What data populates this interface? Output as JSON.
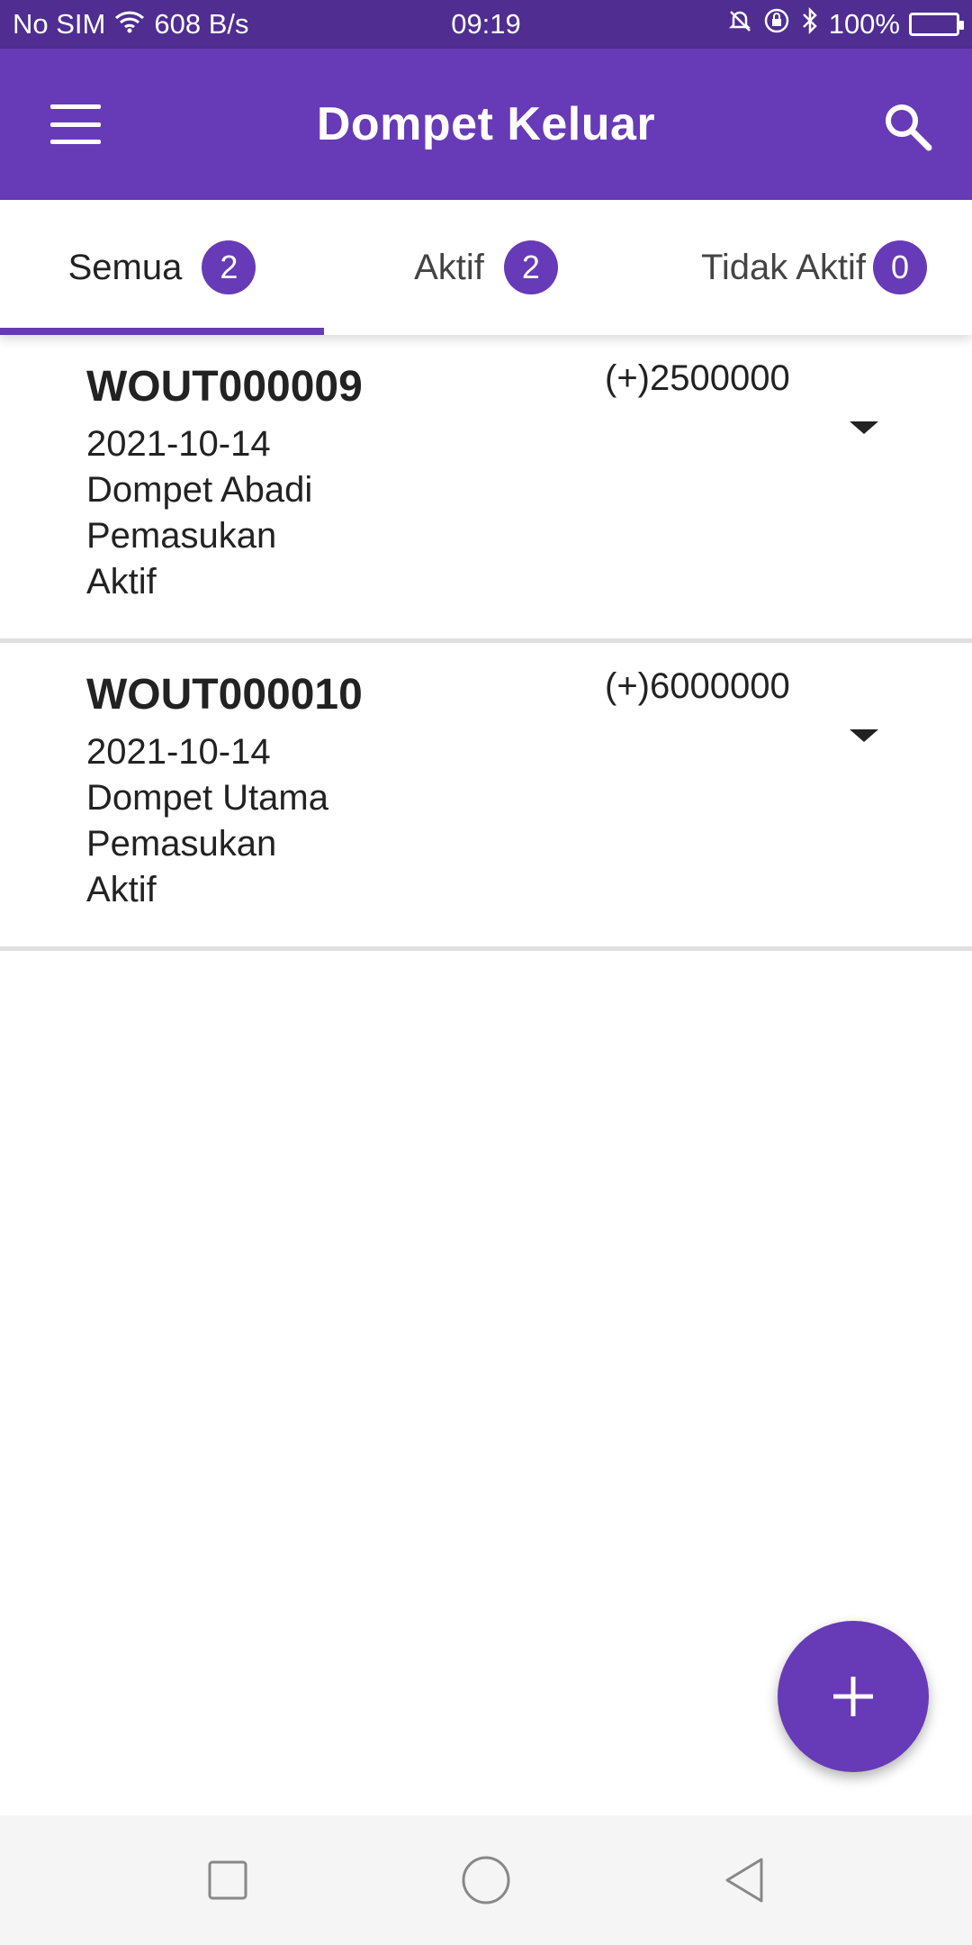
{
  "status_bar": {
    "carrier": "No SIM",
    "speed": "608 B/s",
    "time": "09:19",
    "battery": "100%"
  },
  "app_bar": {
    "title": "Dompet Keluar"
  },
  "tabs": [
    {
      "label": "Semua",
      "count": "2",
      "active": true
    },
    {
      "label": "Aktif",
      "count": "2",
      "active": false
    },
    {
      "label": "Tidak Aktif",
      "count": "0",
      "active": false
    }
  ],
  "entries": [
    {
      "id": "WOUT000009",
      "date": "2021-10-14",
      "wallet": "Dompet Abadi",
      "type": "Pemasukan",
      "status": "Aktif",
      "amount": "(+)2500000"
    },
    {
      "id": "WOUT000010",
      "date": "2021-10-14",
      "wallet": "Dompet Utama",
      "type": "Pemasukan",
      "status": "Aktif",
      "amount": "(+)6000000"
    }
  ],
  "colors": {
    "primary": "#673ab7",
    "status_bar": "#4f2d91",
    "battery": "#2aa0ff"
  },
  "icons": {
    "menu": "hamburger-icon",
    "search": "search-icon",
    "fab": "plus-icon",
    "expand": "caret-down-icon"
  }
}
